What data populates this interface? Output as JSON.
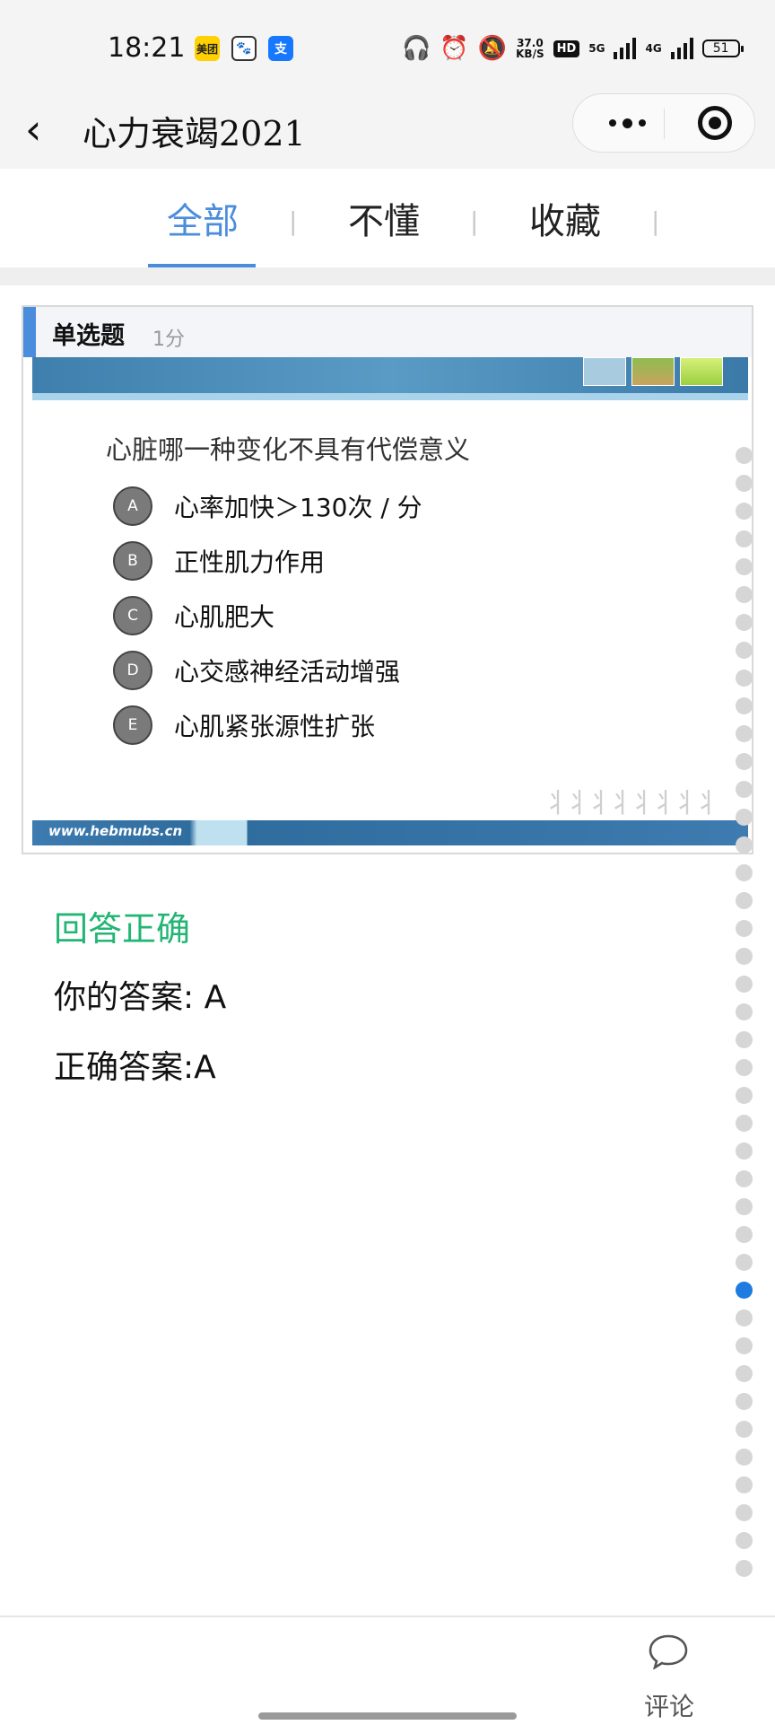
{
  "status_bar": {
    "time": "18:21",
    "apps": [
      {
        "name": "美团",
        "icon": "meituan-icon"
      },
      {
        "name": "",
        "icon": "baidu-icon"
      },
      {
        "name": "支",
        "icon": "alipay-icon"
      }
    ],
    "speed_value": "37.0",
    "speed_unit": "KB/S",
    "hd_label": "HD",
    "network_5g": "5G",
    "network_4g": "4G",
    "battery": "51"
  },
  "nav": {
    "title": "心力衰竭2021"
  },
  "tabs": [
    {
      "label": "全部",
      "active": true
    },
    {
      "label": "不懂",
      "active": false
    },
    {
      "label": "收藏",
      "active": false
    }
  ],
  "tab_divider": "|",
  "question": {
    "type": "单选题",
    "score": "1分",
    "text": "心脏哪一种变化不具有代偿意义",
    "options": [
      {
        "letter": "A",
        "text": "心率加快＞130次 / 分"
      },
      {
        "letter": "B",
        "text": "正性肌力作用"
      },
      {
        "letter": "C",
        "text": "心肌肥大"
      },
      {
        "letter": "D",
        "text": "心交感神经活动增强"
      },
      {
        "letter": "E",
        "text": "心肌紧张源性扩张"
      }
    ],
    "slide_footer_url": "www.hebmubs.cn"
  },
  "answer": {
    "result": "回答正确",
    "yours": "你的答案: A",
    "correct": "正确答案:A"
  },
  "progress_dots": {
    "total": 41,
    "active_index": 30
  },
  "bottom": {
    "comment_label": "评论"
  },
  "colors": {
    "accent": "#4a8ddc",
    "success": "#22b573",
    "active_dot": "#1e7be0"
  }
}
